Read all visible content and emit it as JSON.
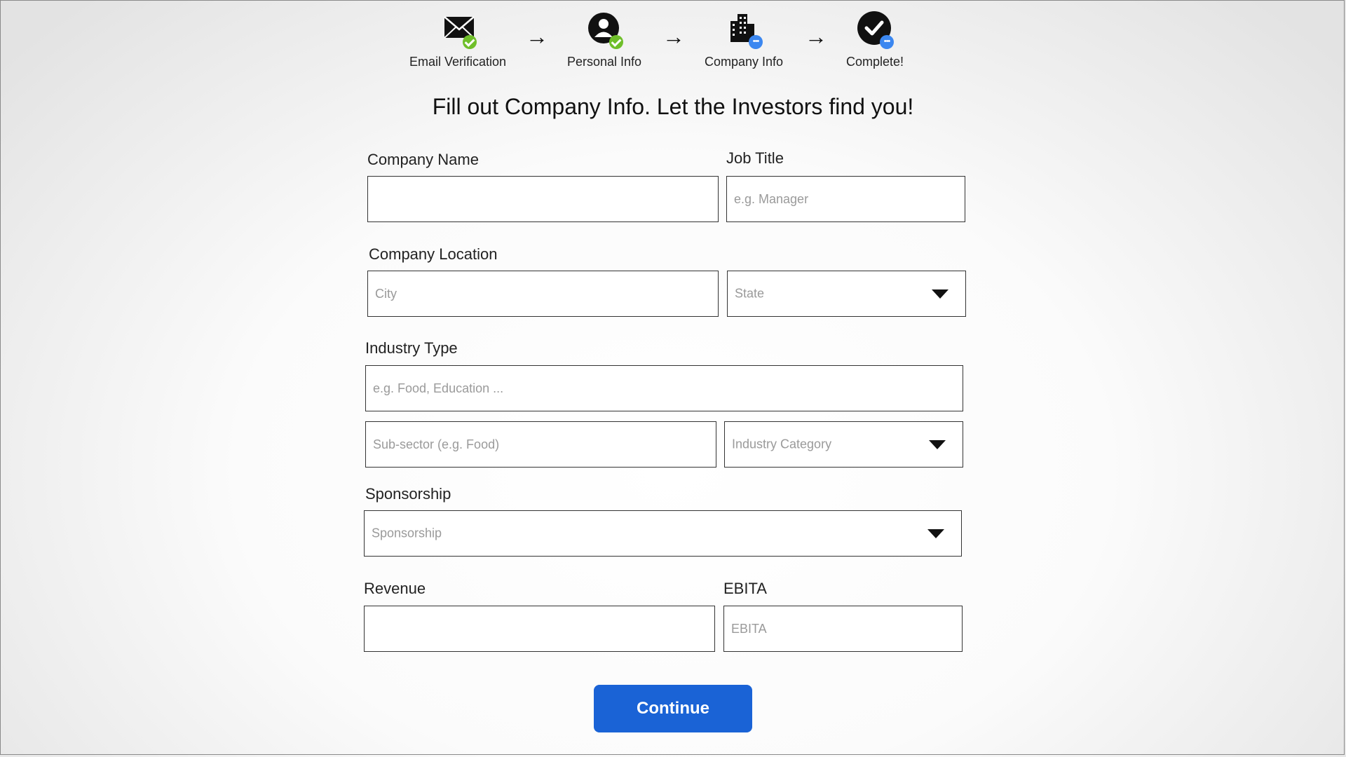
{
  "stepper": {
    "steps": [
      {
        "label": "Email Verification",
        "icon": "envelope-icon",
        "status": "done"
      },
      {
        "label": "Personal Info",
        "icon": "person-icon",
        "status": "done"
      },
      {
        "label": "Company Info",
        "icon": "building-icon",
        "status": "current"
      },
      {
        "label": "Complete!",
        "icon": "checkmark-circle-icon",
        "status": "pending"
      }
    ],
    "arrow": "→"
  },
  "headline": "Fill out Company Info. Let the Investors find you!",
  "form": {
    "company_name": {
      "label": "Company Name",
      "value": "",
      "placeholder": ""
    },
    "job_title": {
      "label": "Job Title",
      "placeholder": "e.g. Manager"
    },
    "company_location": {
      "label": "Company Location",
      "city_placeholder": "City",
      "state_placeholder": "State"
    },
    "industry_type": {
      "label": "Industry Type",
      "placeholder": "e.g. Food, Education ...",
      "subsector_placeholder": "Sub-sector (e.g. Food)",
      "category_placeholder": "Industry Category"
    },
    "sponsorship": {
      "label": "Sponsorship",
      "placeholder": "Sponsorship"
    },
    "revenue": {
      "label": "Revenue",
      "placeholder": ""
    },
    "ebita": {
      "label": "EBITA",
      "placeholder": "EBITA"
    }
  },
  "continue_label": "Continue",
  "colors": {
    "primary_button": "#1a63d6",
    "done_badge": "#6fbf2a",
    "pending_badge": "#3b87f0"
  }
}
